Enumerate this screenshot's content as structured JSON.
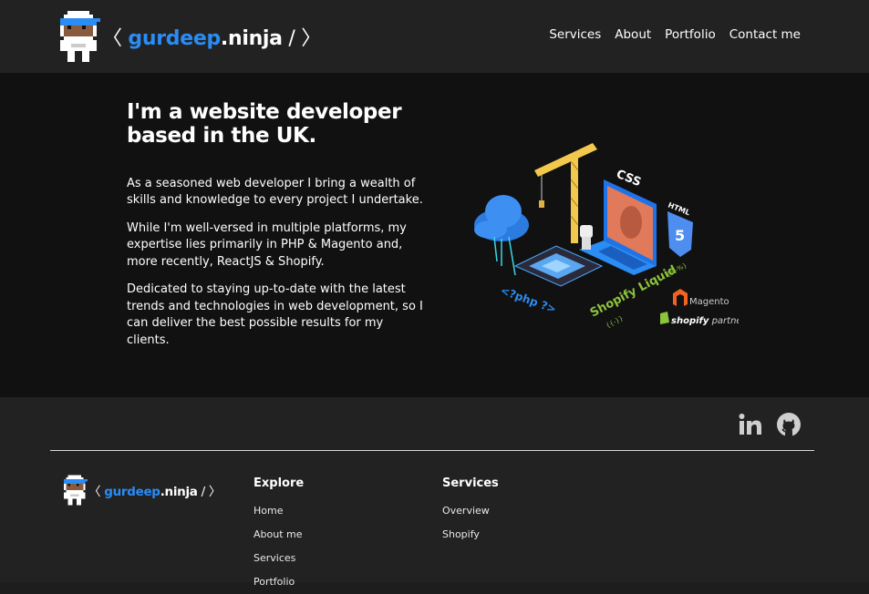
{
  "brand": {
    "prefix": "〈 ",
    "name_highlight": "gurdeep",
    "name_rest": ".ninja",
    "suffix": " / 〉"
  },
  "nav": {
    "items": [
      "Services",
      "About",
      "Portfolio",
      "Contact me"
    ]
  },
  "hero": {
    "title": "I'm a website developer based in the UK.",
    "paragraphs": [
      "As a seasoned web developer I bring a wealth of skills and knowledge to every project I undertake.",
      "While I'm well-versed in multiple platforms, my expertise lies primarily in PHP & Magento and, more recently, ReactJS & Shopify.",
      "Dedicated to staying up-to-date with the latest trends and technologies in web development, so I can deliver the best possible results for my clients."
    ],
    "illustration": {
      "labels": {
        "css": "CSS",
        "html": "HTML",
        "html_num": "5",
        "php": "<?php ?>",
        "shopify_liquid": "Shopify Liquid",
        "liquid_tag1": "{%-%}",
        "liquid_tag2": "{{-}}",
        "magento": "Magento",
        "shopify_partners_bold": "shopify",
        "shopify_partners_rest": " partners"
      }
    }
  },
  "footer": {
    "social": [
      "linkedin-icon",
      "github-icon"
    ],
    "explore": {
      "heading": "Explore",
      "links": [
        "Home",
        "About me",
        "Services",
        "Portfolio"
      ]
    },
    "services": {
      "heading": "Services",
      "links": [
        "Overview",
        "Shopify"
      ]
    }
  },
  "colors": {
    "accent": "#2b8cf4",
    "header_bg": "#222222",
    "hero_bg": "#111111",
    "shopify_green": "#8cc43c",
    "magento_orange": "#f26322"
  }
}
